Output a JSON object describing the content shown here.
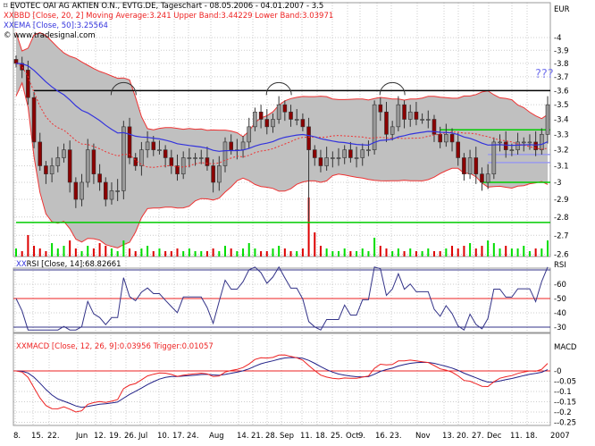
{
  "header": {
    "title": "EVOTEC OAI AG AKTIEN O.N., EVTG.DE, Tageschart - 08.05.2006 - 04.01.2007 - 3.5",
    "bbd": "BBD [Close, 20, 2] Moving Average:3.241 Upper Band:3.44229 Lower Band:3.03971",
    "ema": "EMA [Close, 50]:3.25564",
    "watermark": "© www.tradesignal.com"
  },
  "colors": {
    "up": "#00dd00",
    "down": "#dd0000",
    "band": "#c0c0c0",
    "band_line": "#ee3333",
    "ema": "#3333dd",
    "rsi": "#333388",
    "macd": "#222288",
    "trigger": "#ee2222"
  },
  "chart_data": [
    {
      "type": "candlestick",
      "title": "EVOTEC OAI AG AKTIEN O.N., EVTG.DE, Tageschart",
      "ylabel": "EUR",
      "yscale": "log",
      "ylim": [
        2.6,
        4.05
      ],
      "yticks": [
        "4",
        "3.9",
        "3.8",
        "3.7",
        "3.6",
        "3.5",
        "3.4",
        "3.3",
        "3.2",
        "3.1",
        "3",
        "2.9",
        "2.8",
        "2.7",
        "2.6"
      ],
      "xticks": [
        "8.",
        "15.",
        "22.",
        "Jun",
        "12.",
        "19.",
        "26.",
        "Jul",
        "10.",
        "17.",
        "24.",
        "Aug",
        "14.",
        "21.",
        "28.",
        "Sep",
        "11.",
        "18.",
        "25.",
        "Oct",
        "9.",
        "16.",
        "23.",
        "Nov",
        "13.",
        "20.",
        "27.",
        "Dec",
        "11.",
        "18.",
        "2007"
      ],
      "closes": [
        3.8,
        3.75,
        3.55,
        3.25,
        3.1,
        3.05,
        3.1,
        3.15,
        3.2,
        3.0,
        2.9,
        3.0,
        3.2,
        3.05,
        3.0,
        2.9,
        2.95,
        2.95,
        3.35,
        3.15,
        3.1,
        3.2,
        3.25,
        3.2,
        3.2,
        3.15,
        3.1,
        3.05,
        3.15,
        3.15,
        3.15,
        3.15,
        3.1,
        3.0,
        3.1,
        3.25,
        3.2,
        3.2,
        3.25,
        3.35,
        3.45,
        3.4,
        3.35,
        3.4,
        3.5,
        3.45,
        3.4,
        3.4,
        3.35,
        3.2,
        3.15,
        3.1,
        3.15,
        3.15,
        3.15,
        3.2,
        3.15,
        3.15,
        3.2,
        3.2,
        3.5,
        3.45,
        3.3,
        3.35,
        3.5,
        3.4,
        3.45,
        3.4,
        3.4,
        3.4,
        3.3,
        3.25,
        3.3,
        3.25,
        3.15,
        3.05,
        3.15,
        3.05,
        3.0,
        3.05,
        3.25,
        3.25,
        3.2,
        3.2,
        3.25,
        3.25,
        3.25,
        3.2,
        3.3,
        3.5
      ],
      "spike": {
        "index": 49,
        "low": 2.78
      },
      "volume": [
        3,
        2,
        8,
        4,
        3,
        2,
        5,
        3,
        4,
        6,
        3,
        2,
        4,
        3,
        5,
        4,
        3,
        2,
        6,
        3,
        2,
        3,
        4,
        2,
        3,
        2,
        2,
        3,
        2,
        3,
        2,
        2,
        2,
        3,
        2,
        4,
        3,
        2,
        3,
        5,
        3,
        2,
        2,
        3,
        4,
        3,
        2,
        2,
        3,
        22,
        9,
        4,
        3,
        2,
        2,
        3,
        2,
        2,
        3,
        2,
        7,
        4,
        3,
        2,
        3,
        2,
        3,
        2,
        2,
        3,
        2,
        2,
        3,
        4,
        3,
        4,
        5,
        3,
        4,
        6,
        5,
        3,
        4,
        3,
        3,
        4,
        2,
        3,
        3,
        6
      ],
      "lines": [
        {
          "price": 3.6,
          "color": "#000000",
          "from_index": 3
        },
        {
          "price": 2.77,
          "color": "#00cc00",
          "from_index": 0
        },
        {
          "price": 3.0,
          "color": "#00cc00",
          "from_index": 78
        },
        {
          "price": 3.33,
          "color": "#00cc00",
          "from_index": 71
        },
        {
          "price": 3.17,
          "color": "#9999ee",
          "from_index": 79
        },
        {
          "price": 3.12,
          "color": "#9999ee",
          "from_index": 79
        }
      ],
      "arcs_at_index": [
        18,
        44,
        63
      ],
      "annotation": "???"
    },
    {
      "type": "line",
      "title": "RSI [Close, 14]:68.82661",
      "label": "RSI",
      "yticks": [
        "60",
        "50",
        "40",
        "30"
      ],
      "levels": [
        70,
        50,
        30
      ]
    },
    {
      "type": "line",
      "title": "MACD [Close, 12, 26, 9]:0.03956 Trigger:0.01057",
      "label": "MACD",
      "yticks": [
        "0",
        "-0.05",
        "-0.1",
        "-0.15",
        "-0.2",
        "-0.25"
      ]
    }
  ]
}
